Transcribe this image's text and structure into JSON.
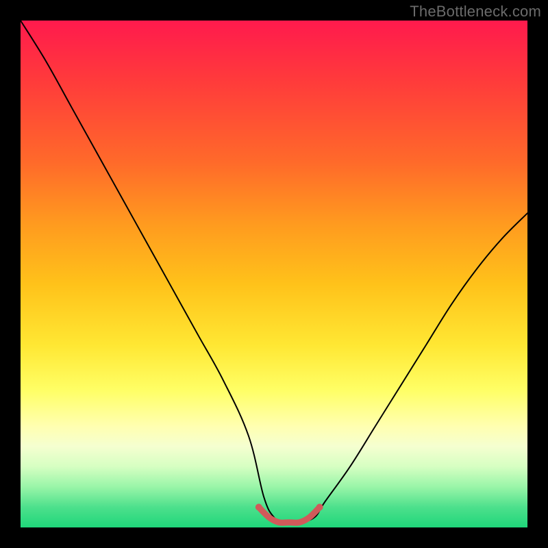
{
  "watermark": "TheBottleneck.com",
  "chart_data": {
    "type": "line",
    "title": "",
    "xlabel": "",
    "ylabel": "",
    "xlim": [
      0,
      100
    ],
    "ylim": [
      0,
      100
    ],
    "grid": false,
    "legend": false,
    "series": [
      {
        "name": "bottleneck-curve",
        "color": "#000000",
        "x": [
          0,
          5,
          10,
          15,
          20,
          25,
          30,
          35,
          40,
          45,
          48,
          50,
          52,
          55,
          58,
          60,
          65,
          70,
          75,
          80,
          85,
          90,
          95,
          100
        ],
        "values": [
          100,
          92,
          83,
          74,
          65,
          56,
          47,
          38,
          29,
          18,
          6,
          2,
          1,
          1,
          2,
          5,
          12,
          20,
          28,
          36,
          44,
          51,
          57,
          62
        ]
      },
      {
        "name": "optimal-range",
        "color": "#d15a5a",
        "x": [
          47,
          49,
          51,
          53,
          55,
          57,
          59
        ],
        "values": [
          4,
          2,
          1,
          1,
          1,
          2,
          4
        ]
      }
    ],
    "annotations": []
  },
  "colors": {
    "frame": "#000000",
    "watermark": "#6b6b6b",
    "curve": "#000000",
    "optimal_marker": "#d15a5a"
  }
}
